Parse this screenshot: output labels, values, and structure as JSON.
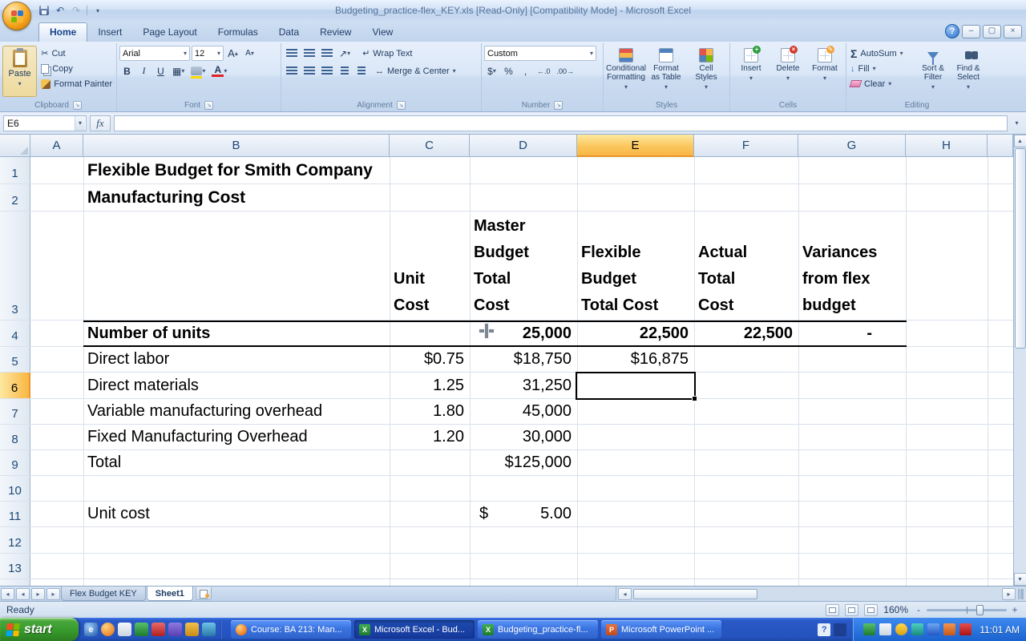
{
  "title_bar": {
    "title": "Budgeting_practice-flex_KEY.xls  [Read-Only]  [Compatibility Mode] - Microsoft Excel"
  },
  "ribbon_tabs": {
    "home": "Home",
    "insert": "Insert",
    "page_layout": "Page Layout",
    "formulas": "Formulas",
    "data": "Data",
    "review": "Review",
    "view": "View"
  },
  "ribbon": {
    "clipboard": {
      "label": "Clipboard",
      "paste": "Paste",
      "cut": "Cut",
      "copy": "Copy",
      "format_painter": "Format Painter"
    },
    "font": {
      "label": "Font",
      "font_name": "Arial",
      "font_size": "12",
      "bold": "B",
      "italic": "I",
      "underline": "U"
    },
    "alignment": {
      "label": "Alignment",
      "wrap_text": "Wrap Text",
      "merge_center": "Merge & Center"
    },
    "number": {
      "label": "Number",
      "format": "Custom",
      "currency": "$",
      "percent": "%",
      "comma": ","
    },
    "styles": {
      "label": "Styles",
      "conditional_formatting": "Conditional\nFormatting",
      "format_as_table": "Format\nas Table",
      "cell_styles": "Cell\nStyles"
    },
    "cells": {
      "label": "Cells",
      "insert": "Insert",
      "delete": "Delete",
      "format": "Format"
    },
    "editing": {
      "label": "Editing",
      "autosum": "AutoSum",
      "fill": "Fill",
      "clear": "Clear",
      "sort_filter": "Sort &\nFilter",
      "find_select": "Find &\nSelect"
    }
  },
  "formula_bar": {
    "name_box": "E6",
    "fx": "fx",
    "formula": ""
  },
  "grid": {
    "selected_cell": "E6",
    "col_headers": [
      "A",
      "B",
      "C",
      "D",
      "E",
      "F",
      "G",
      "H"
    ],
    "row_headers": [
      "1",
      "2",
      "3",
      "4",
      "5",
      "6",
      "7",
      "8",
      "9",
      "10",
      "11",
      "12",
      "13"
    ],
    "cells": {
      "b1": "Flexible Budget for Smith Company",
      "b2": "Manufacturing Cost",
      "c3": "Unit\nCost",
      "d3": "Master\nBudget\nTotal\nCost",
      "e3": "Flexible\nBudget\nTotal Cost",
      "f3": "Actual\nTotal\nCost",
      "g3": "Variances\nfrom flex\nbudget",
      "b4": "Number of units",
      "d4": "25,000",
      "e4": "22,500",
      "f4": "22,500",
      "g4": "-",
      "b5": "Direct labor",
      "c5": "$0.75",
      "d5": "$18,750",
      "e5": "$16,875",
      "b6": "Direct materials",
      "c6": "1.25",
      "d6": "31,250",
      "b7": "Variable manufacturing overhead",
      "c7": "1.80",
      "d7": "45,000",
      "b8": "Fixed Manufacturing Overhead",
      "c8": "1.20",
      "d8": "30,000",
      "b9": "Total",
      "d9": "$125,000",
      "b11": "Unit cost",
      "d11_symbol": "$",
      "d11_value": "5.00"
    }
  },
  "sheet_tabs": {
    "flex_budget_key": "Flex Budget KEY",
    "sheet1": "Sheet1"
  },
  "status_bar": {
    "mode": "Ready",
    "zoom": "160%"
  },
  "taskbar": {
    "start": "start",
    "task1": "Course: BA 213: Man...",
    "task2": "Microsoft Excel - Bud...",
    "task3": "Budgeting_practice-fl...",
    "task4": "Microsoft PowerPoint ...",
    "time": "11:01 AM"
  },
  "icons": {
    "dropdown": "▾",
    "grow_font": "▴",
    "dialog_launcher": "↘",
    "scissors": "✂",
    "undo": "↶",
    "redo": "↷",
    "sigma": "Σ",
    "fill_down": "↓",
    "borders": "▦",
    "orientation": "↗",
    "wrap": "↵",
    "merge": "↔",
    "help": "?",
    "minimize": "–",
    "restore": "▢",
    "close": "×",
    "scroll_up": "▲",
    "scroll_down": "▼",
    "scroll_left": "◂",
    "scroll_right": "▸",
    "increase_decimal": "←.0",
    "decrease_decimal": ".00→",
    "excel_letter": "X",
    "powerpoint_letter": "P",
    "ie_letter": "e",
    "zoom_out": "-",
    "zoom_in": "+"
  },
  "colors": {
    "selection_header": "#f9b643",
    "taskbar_blue": "#2452bd",
    "start_green": "#379a2b",
    "gridline": "#d9e1ec"
  }
}
